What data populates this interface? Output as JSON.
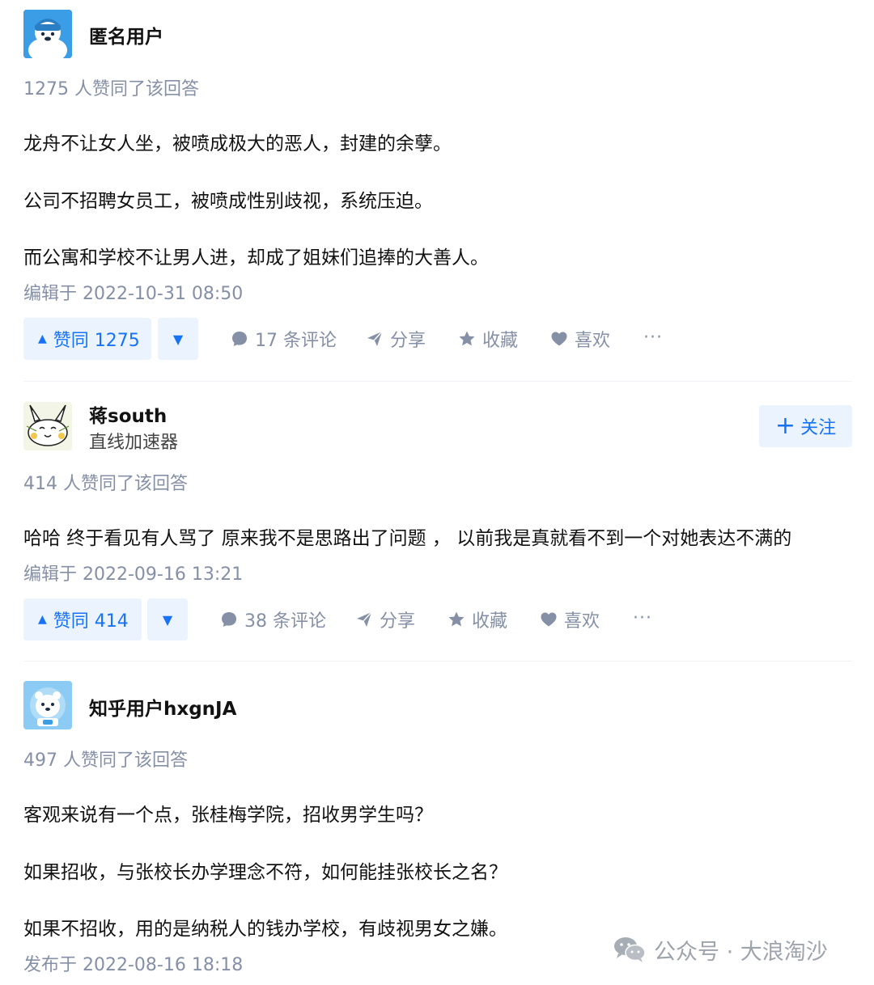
{
  "answers": [
    {
      "author": "匿名用户",
      "bio": "",
      "votes_text": "1275 人赞同了该回答",
      "paragraphs": [
        "龙舟不让女人坐，被喷成极大的恶人，封建的余孽。",
        "公司不招聘女员工，被喷成性别歧视，系统压迫。",
        "而公寓和学校不让男人进，却成了姐妹们追捧的大善人。"
      ],
      "time": "编辑于 2022-10-31 08:50",
      "vote_label": "赞同 1275",
      "comments": "17 条评论",
      "share": "分享",
      "collect": "收藏",
      "like": "喜欢",
      "more": "···"
    },
    {
      "author": "蒋south",
      "bio": "直线加速器",
      "follow_label": "关注",
      "votes_text": "414 人赞同了该回答",
      "paragraphs": [
        "哈哈 终于看见有人骂了 原来我不是思路出了问题 ， 以前我是真就看不到一个对她表达不满的"
      ],
      "time": "编辑于 2022-09-16 13:21",
      "vote_label": "赞同 414",
      "comments": "38 条评论",
      "share": "分享",
      "collect": "收藏",
      "like": "喜欢",
      "more": "···"
    },
    {
      "author": "知乎用户hxgnJA",
      "bio": "",
      "votes_text": "497 人赞同了该回答",
      "paragraphs": [
        "客观来说有一个点，张桂梅学院，招收男学生吗？",
        "如果招收，与张校长办学理念不符，如何能挂张校长之名？",
        "如果不招收，用的是纳税人的钱办学校，有歧视男女之嫌。"
      ],
      "time": "发布于 2022-08-16 18:18"
    }
  ],
  "watermark": "公众号 · 大浪淘沙",
  "colors": {
    "accent": "#1772f6",
    "accent_bg": "#ebf3ff",
    "muted": "#8590a6",
    "text": "#121212"
  },
  "icons": {
    "vote_up": "triangle-up-icon",
    "vote_down": "triangle-down-icon",
    "comment": "comment-bubble-icon",
    "share": "paper-plane-icon",
    "collect": "star-icon",
    "like": "heart-icon",
    "follow": "plus-icon",
    "watermark": "wechat-icon"
  }
}
